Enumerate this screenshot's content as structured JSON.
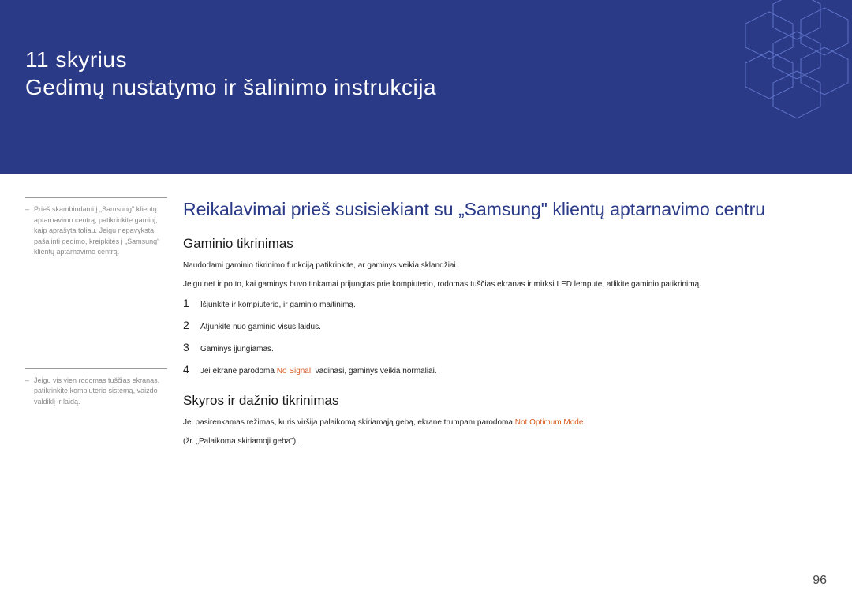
{
  "header": {
    "chapter_num": "11 skyrius",
    "chapter_title": "Gedimų nustatymo ir šalinimo instrukcija"
  },
  "sidebar": {
    "note1": "Prieš skambindami į „Samsung\" klientų aptarnavimo centrą, patikrinkite gaminį, kaip aprašyta toliau. Jeigu nepavyksta pašalinti gedimo, kreipkitės į „Samsung\" klientų aptarnavimo centrą.",
    "note2": "Jeigu vis vien rodomas tuščias ekranas, patikrinkite kompiuterio sistemą, vaizdo valdiklį ir laidą."
  },
  "main": {
    "h1": "Reikalavimai prieš susisiekiant su „Samsung\" klientų aptarnavimo centru",
    "h2a": "Gaminio tikrinimas",
    "p1": "Naudodami gaminio tikrinimo funkciją patikrinkite, ar gaminys veikia sklandžiai.",
    "p2": "Jeigu net ir po to, kai gaminys buvo tinkamai prijungtas prie kompiuterio, rodomas tuščias ekranas ir mirksi LED lemputė, atlikite gaminio patikrinimą.",
    "steps": {
      "s1": "Išjunkite ir kompiuterio, ir gaminio maitinimą.",
      "s2": "Atjunkite nuo gaminio visus laidus.",
      "s3": "Gaminys įjungiamas.",
      "s4a": "Jei ekrane parodoma ",
      "s4_hl": "No Signal",
      "s4b": ", vadinasi, gaminys veikia normaliai."
    },
    "h2b": "Skyros ir dažnio tikrinimas",
    "p3a": "Jei pasirenkamas režimas, kuris viršija palaikomą skiriamąją gebą, ekrane trumpam parodoma ",
    "p3_hl": "Not Optimum Mode",
    "p3b": ".",
    "p4": "(žr. „Palaikoma skiriamoji geba\")."
  },
  "page_number": "96"
}
